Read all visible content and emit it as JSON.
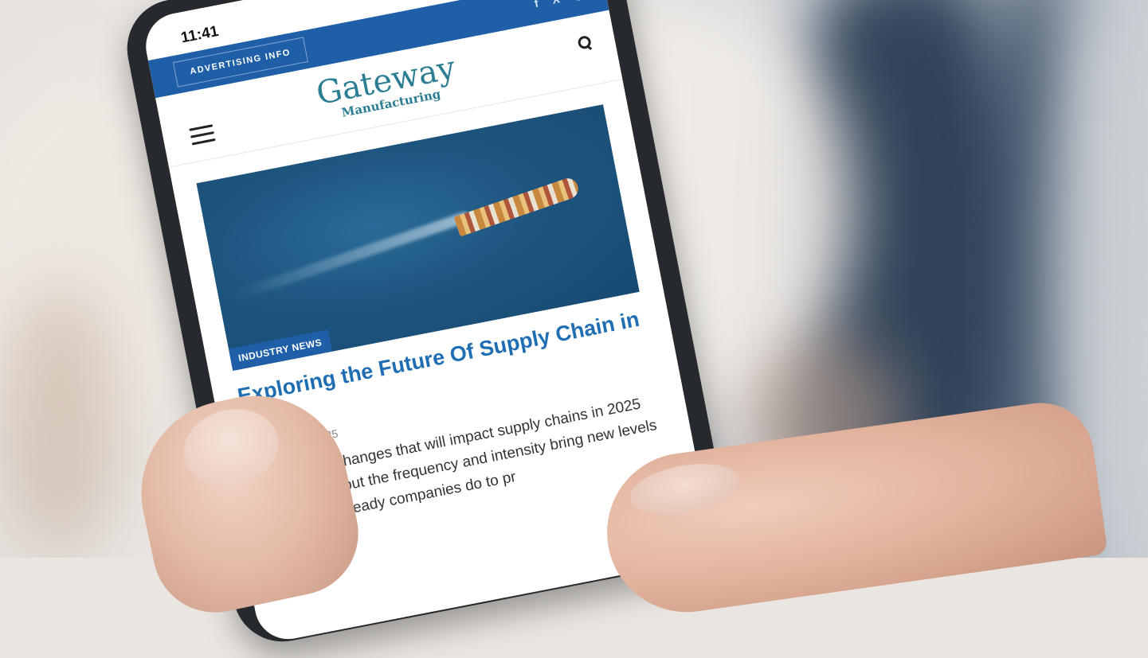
{
  "status_bar": {
    "time": "11:41"
  },
  "topbar": {
    "advertising_label": "ADVERTISING INFO",
    "social": [
      "f",
      "X",
      "◎"
    ]
  },
  "header": {
    "logo_main": "Gateway",
    "logo_sub": "Manufacturing"
  },
  "article": {
    "category": "INDUSTRY NEWS",
    "title": "Exploring the Future Of Supply Chain in 2025",
    "date": "February 14, 2025",
    "excerpt": "Many of the changes that will impact supply chains in 2025 are not new, but the frequency and intensity bring new levels of strain to already companies do to pr"
  },
  "icons": [
    "menu-icon",
    "search-icon",
    "signal-icon",
    "wifi-icon",
    "battery-icon",
    "facebook-icon",
    "x-icon",
    "instagram-icon"
  ]
}
